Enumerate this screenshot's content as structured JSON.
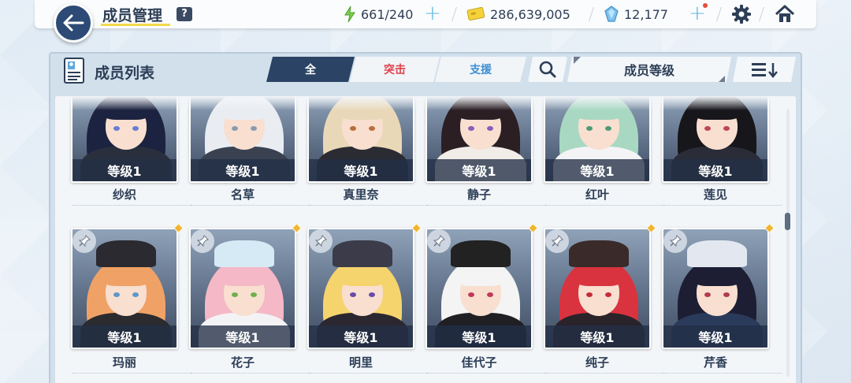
{
  "header": {
    "title": "成员管理",
    "help": "?",
    "stamina": "661/240",
    "credits": "286,639,005",
    "gems": "12,177"
  },
  "panel": {
    "title": "成员列表",
    "tabs": [
      "全",
      "突击",
      "支援"
    ],
    "sort_label": "成员等级"
  },
  "members_row1": [
    {
      "name": "纱织",
      "level": "等级1",
      "hair": "#1c2340",
      "body": "#2a2f3d",
      "eye": "#6a7bd6"
    },
    {
      "name": "名草",
      "level": "等级1",
      "hair": "#e9edf2",
      "body": "#3a4252",
      "eye": "#8a9ab0"
    },
    {
      "name": "真里奈",
      "level": "等级1",
      "hair": "#e9d8b8",
      "body": "#2b2b33",
      "eye": "#b86e3c"
    },
    {
      "name": "静子",
      "level": "等级1",
      "hair": "#2b1f24",
      "body": "#f1ece8",
      "eye": "#8b5bb8"
    },
    {
      "name": "红叶",
      "level": "等级1",
      "hair": "#a9d8c2",
      "body": "#f4f4f6",
      "eye": "#4e9a78"
    },
    {
      "name": "莲见",
      "level": "等级1",
      "hair": "#17161b",
      "body": "#2a2d38",
      "eye": "#c04555"
    }
  ],
  "members_row2": [
    {
      "name": "玛丽",
      "level": "等级1",
      "hair": "#f0a266",
      "body": "#2b2a2f",
      "eye": "#5d97c9",
      "accent": "#2a2a30"
    },
    {
      "name": "花子",
      "level": "等级1",
      "hair": "#f4b8c6",
      "body": "#f3f3f6",
      "eye": "#6fb04b",
      "accent": "#d6eaf6"
    },
    {
      "name": "明里",
      "level": "等级1",
      "hair": "#f5d46e",
      "body": "#2a2730",
      "eye": "#6a4aa8",
      "accent": "#3b3b4a"
    },
    {
      "name": "佳代子",
      "level": "等级1",
      "hair": "#f4f4f4",
      "body": "#1f1f24",
      "eye": "#c0395a",
      "accent": "#222"
    },
    {
      "name": "纯子",
      "level": "等级1",
      "hair": "#d9333f",
      "body": "#2a2329",
      "eye": "#c62b3a",
      "accent": "#3a2a2a"
    },
    {
      "name": "芹香",
      "level": "等级1",
      "hair": "#1d1e33",
      "body": "#2a3a5a",
      "eye": "#b23b4f",
      "accent": "#e3e8f0"
    }
  ]
}
